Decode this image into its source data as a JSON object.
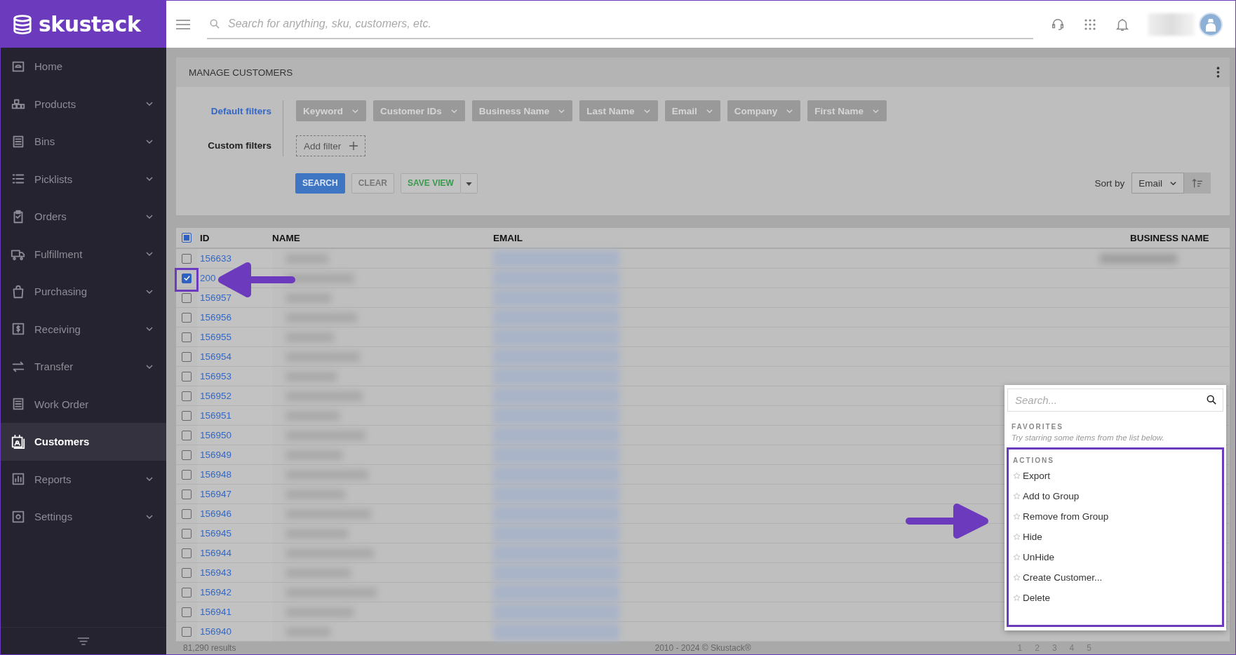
{
  "logo": {
    "text": "skustack"
  },
  "search": {
    "placeholder": "Search for anything, sku, customers, etc."
  },
  "sidebar": {
    "items": [
      {
        "label": "Home",
        "expandable": false,
        "selected": false
      },
      {
        "label": "Products",
        "expandable": true,
        "selected": false
      },
      {
        "label": "Bins",
        "expandable": true,
        "selected": false
      },
      {
        "label": "Picklists",
        "expandable": true,
        "selected": false
      },
      {
        "label": "Orders",
        "expandable": true,
        "selected": false
      },
      {
        "label": "Fulfillment",
        "expandable": true,
        "selected": false
      },
      {
        "label": "Purchasing",
        "expandable": true,
        "selected": false
      },
      {
        "label": "Receiving",
        "expandable": true,
        "selected": false
      },
      {
        "label": "Transfer",
        "expandable": true,
        "selected": false
      },
      {
        "label": "Work Order",
        "expandable": false,
        "selected": false
      },
      {
        "label": "Customers",
        "expandable": false,
        "selected": true
      },
      {
        "label": "Reports",
        "expandable": true,
        "selected": false
      },
      {
        "label": "Settings",
        "expandable": true,
        "selected": false
      }
    ]
  },
  "card": {
    "title": "MANAGE CUSTOMERS",
    "default_filters_label": "Default filters",
    "custom_filters_label": "Custom filters",
    "filters": [
      "Keyword",
      "Customer IDs",
      "Business Name",
      "Last Name",
      "Email",
      "Company",
      "First Name"
    ],
    "add_filter": "Add filter",
    "buttons": {
      "search": "SEARCH",
      "clear": "CLEAR",
      "save_view": "SAVE VIEW"
    },
    "sort_label": "Sort by",
    "sort_value": "Email"
  },
  "table": {
    "select_all_partial": true,
    "columns": [
      "ID",
      "NAME",
      "EMAIL",
      "BUSINESS NAME"
    ],
    "rows": [
      {
        "id": "156633",
        "checked": false
      },
      {
        "id": "200",
        "checked": true
      },
      {
        "id": "156957",
        "checked": false
      },
      {
        "id": "156956",
        "checked": false
      },
      {
        "id": "156955",
        "checked": false
      },
      {
        "id": "156954",
        "checked": false
      },
      {
        "id": "156953",
        "checked": false
      },
      {
        "id": "156952",
        "checked": false
      },
      {
        "id": "156951",
        "checked": false
      },
      {
        "id": "156950",
        "checked": false
      },
      {
        "id": "156949",
        "checked": false
      },
      {
        "id": "156948",
        "checked": false
      },
      {
        "id": "156947",
        "checked": false
      },
      {
        "id": "156946",
        "checked": false
      },
      {
        "id": "156945",
        "checked": false
      },
      {
        "id": "156944",
        "checked": false
      },
      {
        "id": "156943",
        "checked": false
      },
      {
        "id": "156942",
        "checked": false
      },
      {
        "id": "156941",
        "checked": false
      },
      {
        "id": "156940",
        "checked": false
      }
    ]
  },
  "menu": {
    "search_placeholder": "Search...",
    "favorites_heading": "FAVORITES",
    "favorites_hint": "Try starring some items from the list below.",
    "actions_heading": "ACTIONS",
    "actions": [
      "Export",
      "Add to Group",
      "Remove from Group",
      "Hide",
      "UnHide",
      "Create Customer...",
      "Delete"
    ]
  },
  "footer": {
    "results": "81,290 results",
    "copyright": "2010 - 2024 © Skustack®",
    "pages": [
      "1",
      "2",
      "3",
      "4",
      "5"
    ]
  }
}
